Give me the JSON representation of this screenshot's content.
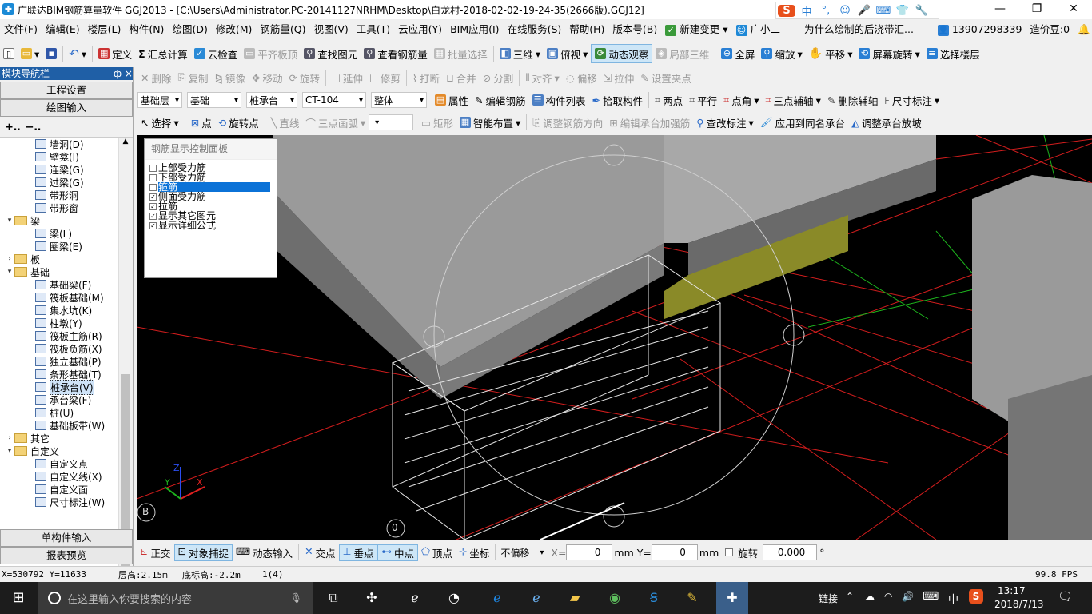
{
  "window": {
    "title": "广联达BIM钢筋算量软件 GGJ2013 - [C:\\Users\\Administrator.PC-20141127NRHM\\Desktop\\白龙村-2018-02-02-19-24-35(2666版).GGJ12]",
    "ime_chars": [
      "中",
      "°,",
      "☺",
      "🎤",
      "⌨",
      "👕",
      "🔧"
    ],
    "ime_logo": "S"
  },
  "menu": {
    "items": [
      "文件(F)",
      "编辑(E)",
      "楼层(L)",
      "构件(N)",
      "绘图(D)",
      "修改(M)",
      "钢筋量(Q)",
      "视图(V)",
      "工具(T)",
      "云应用(Y)",
      "BIM应用(I)",
      "在线服务(S)",
      "帮助(H)",
      "版本号(B)",
      "新建变更",
      "广小二"
    ],
    "notice": "为什么绘制的后浇带汇...",
    "phone": "13907298339",
    "price": "造价豆:0"
  },
  "toolbar1": [
    "定义",
    "汇总计算",
    "云检查",
    "平齐板顶",
    "查找图元",
    "查看钢筋量",
    "批量选择",
    "三维",
    "俯视",
    "动态观察",
    "局部三维",
    "全屏",
    "缩放",
    "平移",
    "屏幕旋转",
    "选择楼层"
  ],
  "toolbar2": [
    "删除",
    "复制",
    "镜像",
    "移动",
    "旋转",
    "延伸",
    "修剪",
    "打断",
    "合并",
    "分割",
    "对齐",
    "偏移",
    "拉伸",
    "设置夹点"
  ],
  "toolbar3": {
    "dropdowns": [
      "基础层",
      "基础",
      "桩承台",
      "CT-104",
      "整体"
    ],
    "buttons": [
      "属性",
      "编辑钢筋",
      "构件列表",
      "拾取构件",
      "两点",
      "平行",
      "点角",
      "三点辅轴",
      "删除辅轴",
      "尺寸标注"
    ]
  },
  "toolbar4": [
    "选择",
    "点",
    "旋转点",
    "直线",
    "三点画弧",
    "矩形",
    "智能布置",
    "调整钢筋方向",
    "编辑承台加强筋",
    "查改标注",
    "应用到同名承台",
    "调整承台放坡"
  ],
  "nav": {
    "header": "模块导航栏",
    "pin": "ф ×",
    "top_buttons": [
      "工程设置",
      "绘图输入"
    ],
    "bottom_buttons": [
      "单构件输入",
      "报表预览"
    ],
    "tree": [
      {
        "label": "墙洞(D)",
        "level": 2,
        "type": "item"
      },
      {
        "label": "壁龛(I)",
        "level": 2,
        "type": "item"
      },
      {
        "label": "连梁(G)",
        "level": 2,
        "type": "item"
      },
      {
        "label": "过梁(G)",
        "level": 2,
        "type": "item"
      },
      {
        "label": "带形洞",
        "level": 2,
        "type": "item"
      },
      {
        "label": "带形窗",
        "level": 2,
        "type": "item"
      },
      {
        "label": "梁",
        "level": 1,
        "type": "folder",
        "open": true
      },
      {
        "label": "梁(L)",
        "level": 2,
        "type": "item"
      },
      {
        "label": "圈梁(E)",
        "level": 2,
        "type": "item"
      },
      {
        "label": "板",
        "level": 1,
        "type": "folder",
        "open": false
      },
      {
        "label": "基础",
        "level": 1,
        "type": "folder",
        "open": true
      },
      {
        "label": "基础梁(F)",
        "level": 2,
        "type": "item"
      },
      {
        "label": "筏板基础(M)",
        "level": 2,
        "type": "item"
      },
      {
        "label": "集水坑(K)",
        "level": 2,
        "type": "item"
      },
      {
        "label": "柱墩(Y)",
        "level": 2,
        "type": "item"
      },
      {
        "label": "筏板主筋(R)",
        "level": 2,
        "type": "item"
      },
      {
        "label": "筏板负筋(X)",
        "level": 2,
        "type": "item"
      },
      {
        "label": "独立基础(P)",
        "level": 2,
        "type": "item"
      },
      {
        "label": "条形基础(T)",
        "level": 2,
        "type": "item"
      },
      {
        "label": "桩承台(V)",
        "level": 2,
        "type": "item",
        "selected": true
      },
      {
        "label": "承台梁(F)",
        "level": 2,
        "type": "item"
      },
      {
        "label": "桩(U)",
        "level": 2,
        "type": "item"
      },
      {
        "label": "基础板带(W)",
        "level": 2,
        "type": "item"
      },
      {
        "label": "其它",
        "level": 1,
        "type": "folder",
        "open": false
      },
      {
        "label": "自定义",
        "level": 1,
        "type": "folder",
        "open": true
      },
      {
        "label": "自定义点",
        "level": 2,
        "type": "item"
      },
      {
        "label": "自定义线(X)",
        "level": 2,
        "type": "item"
      },
      {
        "label": "自定义面",
        "level": 2,
        "type": "item"
      },
      {
        "label": "尺寸标注(W)",
        "level": 2,
        "type": "item"
      }
    ]
  },
  "rebar_panel": {
    "title": "钢筋显示控制面板",
    "items": [
      {
        "label": "上部受力筋",
        "checked": false
      },
      {
        "label": "下部受力筋",
        "checked": false
      },
      {
        "label": "箍筋",
        "checked": false,
        "selected": true
      },
      {
        "label": "侧面受力筋",
        "checked": true
      },
      {
        "label": "拉筋",
        "checked": true
      },
      {
        "label": "显示其它图元",
        "checked": true
      },
      {
        "label": "显示详细公式",
        "checked": true
      }
    ]
  },
  "viewport": {
    "axis_labels": [
      "Z",
      "Y",
      "X"
    ],
    "grid_markers": [
      "B",
      "0"
    ]
  },
  "snapbar": {
    "buttons": [
      "正交",
      "对象捕捉",
      "动态输入",
      "交点",
      "垂点",
      "中点",
      "顶点",
      "坐标"
    ],
    "offset_mode": "不偏移",
    "x_label": "X=",
    "x_value": "0",
    "y_label": "Y=",
    "y_value": "0",
    "unit": "mm",
    "rotate_label": "旋转",
    "rotate_value": "0.000",
    "degree": "°"
  },
  "coords": {
    "xy": "X=530792 Y=11633",
    "floor_height": "层高:2.15m",
    "base_height": "底标高:-2.2m",
    "count": "1(4)",
    "fps": "99.8 FPS"
  },
  "taskbar": {
    "search_placeholder": "在这里输入你要搜索的内容",
    "tray_text": "链接",
    "ime": "中",
    "time": "13:17",
    "date": "2018/7/13"
  }
}
